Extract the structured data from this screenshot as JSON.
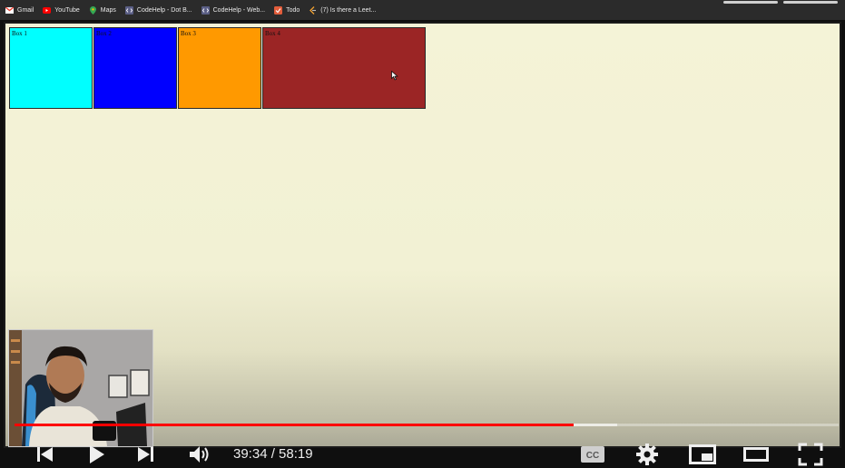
{
  "bookmarks": [
    {
      "label": "Gmail",
      "icon": "gmail-icon",
      "color": "#ea4335"
    },
    {
      "label": "YouTube",
      "icon": "youtube-icon",
      "color": "#ff0000"
    },
    {
      "label": "Maps",
      "icon": "maps-icon",
      "color": "#34a853"
    },
    {
      "label": "CodeHelp - Dot B...",
      "icon": "codehelp-icon",
      "color": "#7a7aa0"
    },
    {
      "label": "CodeHelp - Web...",
      "icon": "codehelp-icon",
      "color": "#7a7aa0"
    },
    {
      "label": "Todo",
      "icon": "todo-icon",
      "color": "#e35d3b"
    },
    {
      "label": "(7) Is there a Leet...",
      "icon": "leetcode-icon",
      "color": "#f0a030"
    }
  ],
  "page": {
    "boxes": [
      {
        "label": "Box 1",
        "color": "#00ffff"
      },
      {
        "label": "Box 2",
        "color": "#0000ff"
      },
      {
        "label": "Box 3",
        "color": "#ff9900"
      },
      {
        "label": "Box 4",
        "color": "#9b2525"
      }
    ],
    "background": "#f4f3d7"
  },
  "player": {
    "current_time": "39:34",
    "separator": "/",
    "duration": "58:19",
    "time_display": "39:34 / 58:19",
    "played_fraction": 0.678,
    "buffered_fraction": 0.731,
    "progress_color": "#ff0000",
    "controls": {
      "prev": "previous-icon",
      "play": "play-icon",
      "next": "next-icon",
      "volume": "volume-icon",
      "captions": "captions-icon",
      "settings": "gear-icon",
      "miniplayer": "miniplayer-icon",
      "theater": "theater-mode-icon",
      "fullscreen": "fullscreen-icon"
    }
  }
}
